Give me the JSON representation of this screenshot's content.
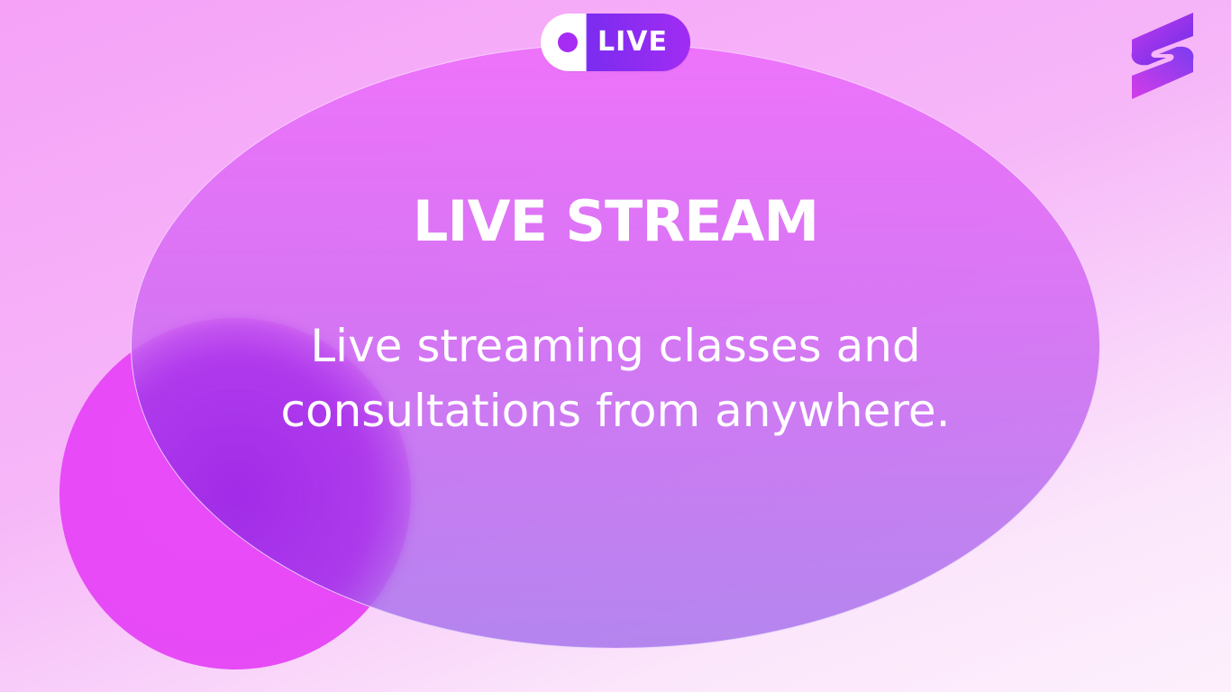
{
  "badge": {
    "label": "LIVE"
  },
  "slide": {
    "title": "LIVE STREAM",
    "subtitle": "Live streaming classes and consultations from anywhere."
  },
  "icons": {
    "logo": "brand-s-logo-icon",
    "live_dot": "record-dot-icon"
  },
  "colors": {
    "accent_purple": "#a72cf3",
    "accent_pink": "#e84cf8"
  }
}
